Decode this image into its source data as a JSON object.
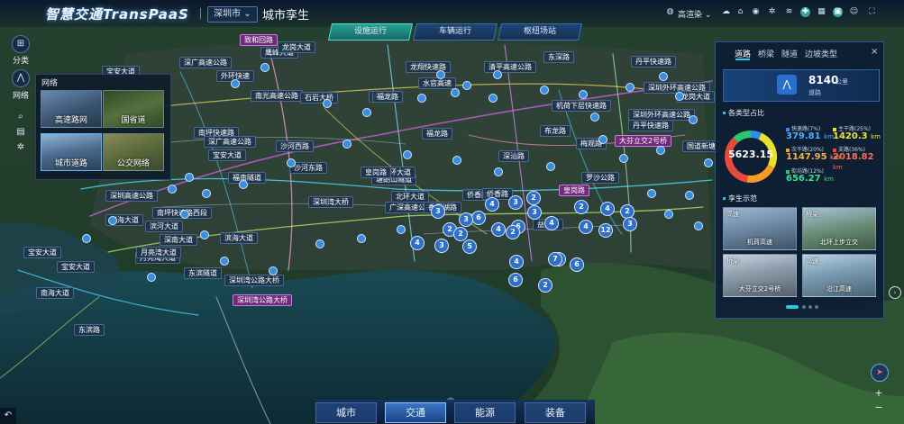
{
  "header": {
    "app_title": "智慧交通TransPaaS",
    "city": "深圳市",
    "page_subtitle": "城市孪生",
    "quality": "高渲染"
  },
  "top_tabs": [
    {
      "label": "设施运行",
      "active": true
    },
    {
      "label": "车辆运行",
      "active": false
    },
    {
      "label": "枢纽场站",
      "active": false
    }
  ],
  "left_rail": {
    "category_label": "分类",
    "network_label": "网络"
  },
  "network_panel": {
    "title": "网络",
    "options": [
      {
        "label": "高速路网",
        "selected": false
      },
      {
        "label": "国省道",
        "selected": false
      },
      {
        "label": "城市道路",
        "selected": true
      },
      {
        "label": "公交网络",
        "selected": false
      }
    ]
  },
  "right_panel": {
    "tabs": [
      "道路",
      "桥梁",
      "隧道",
      "边坡类型"
    ],
    "active_tab": "道路",
    "close": "×",
    "total": {
      "value": "8140",
      "unit": "公里",
      "label": "道路"
    },
    "ratio_title": "各类型占比",
    "ratio_total": "5623.15",
    "categories": [
      {
        "name": "快速路(7%)",
        "value": "379.81",
        "unit": "km",
        "color": "#2f8df0"
      },
      {
        "name": "主干路(25%)",
        "value": "1420.3",
        "unit": "km",
        "color": "#e8e02c"
      },
      {
        "name": "次干路(20%)",
        "value": "1147.95",
        "unit": "km",
        "color": "#f59a23"
      },
      {
        "name": "支路(36%)",
        "value": "2018.82",
        "unit": "km",
        "color": "#e84a3a"
      },
      {
        "name": "街坊路(12%)",
        "value": "656.27",
        "unit": "km",
        "color": "#28c76f"
      }
    ],
    "showcase_title": "孪生示范",
    "showcase": [
      {
        "tag": "高速",
        "caption": "机荷高速"
      },
      {
        "tag": "桥梁",
        "caption": "北环上步立交"
      },
      {
        "tag": "桥梁",
        "caption": "大芬立交2号桥"
      },
      {
        "tag": "高速",
        "caption": "沿江高速"
      }
    ]
  },
  "bottom_nav": [
    {
      "label": "城市",
      "active": false
    },
    {
      "label": "交通",
      "active": true
    },
    {
      "label": "能源",
      "active": false
    },
    {
      "label": "装备",
      "active": false
    }
  ],
  "map_labels": [
    "宝安大道",
    "致和回路",
    "鹰峰大道",
    "外环快速",
    "深广高速公路",
    "龙翔快速路",
    "龙岗大道",
    "水官高速",
    "清平高速公路",
    "东深路",
    "丹平快速路",
    "深圳外环高速公路",
    "福田区",
    "南光高速公路",
    "石岩大桥",
    "福龙路",
    "龙岗大道",
    "机荷下层快速路",
    "深圳外环高速公路",
    "大芬立交2号桥",
    "国道新塘",
    "福龙路",
    "南坪快速路",
    "布龙路",
    "丹平快速路",
    "沙河西路",
    "宝安大道",
    "宝安大道",
    "梅观路",
    "深汕路",
    "塘朗山隧道",
    "北环大道",
    "罗沙公路",
    "侨香路",
    "广深高速公路",
    "香蜜湖路",
    "益田路",
    "深圳高速公路",
    "滨河大道",
    "深南大道",
    "滨海大道",
    "月亮湾大道",
    "东滨隧道",
    "深圳湾公路大桥",
    "深圳湾公路大桥",
    "沙河东路",
    "深圳湾大桥",
    "皇岗路",
    "宝安大道",
    "南坪快速路西段",
    "兴海大道",
    "宝安大道",
    "月亮湾大道",
    "南海大道",
    "东滨路",
    "深广高速公路",
    "福南隧道",
    "侨香路",
    "北环大道",
    "皇岗路"
  ],
  "count_markers": [
    "3",
    "2",
    "6",
    "4",
    "3",
    "2",
    "5",
    "3",
    "2",
    "6",
    "3",
    "4",
    "2",
    "12",
    "4",
    "2",
    "3",
    "4",
    "2",
    "4",
    "7",
    "6",
    "2",
    "4",
    "6",
    "4",
    "3",
    "2"
  ]
}
